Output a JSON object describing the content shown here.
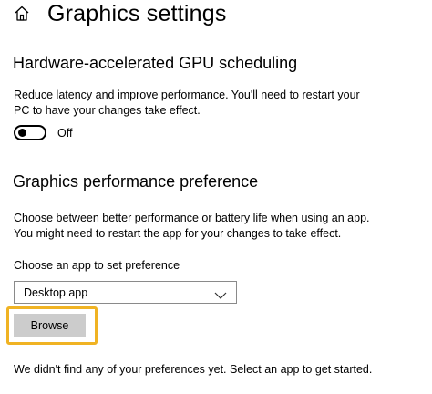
{
  "header": {
    "title": "Graphics settings",
    "icon": "home-icon"
  },
  "gpu_scheduling": {
    "title": "Hardware-accelerated GPU scheduling",
    "description_line1": "Reduce latency and improve performance. You'll need to restart your",
    "description_line2": "PC to have your changes take effect.",
    "toggle_state": "Off"
  },
  "performance_preference": {
    "title": "Graphics performance preference",
    "description_line1": "Choose between better performance or battery life when using an app.",
    "description_line2": "You might need to restart the app for your changes to take effect.",
    "choose_label": "Choose an app to set preference",
    "selected_app_type": "Desktop app",
    "browse_label": "Browse",
    "empty_message": "We didn't find any of your preferences yet. Select an app to get started."
  },
  "colors": {
    "highlight": "#f0b323",
    "button_bg": "#cccccc"
  }
}
